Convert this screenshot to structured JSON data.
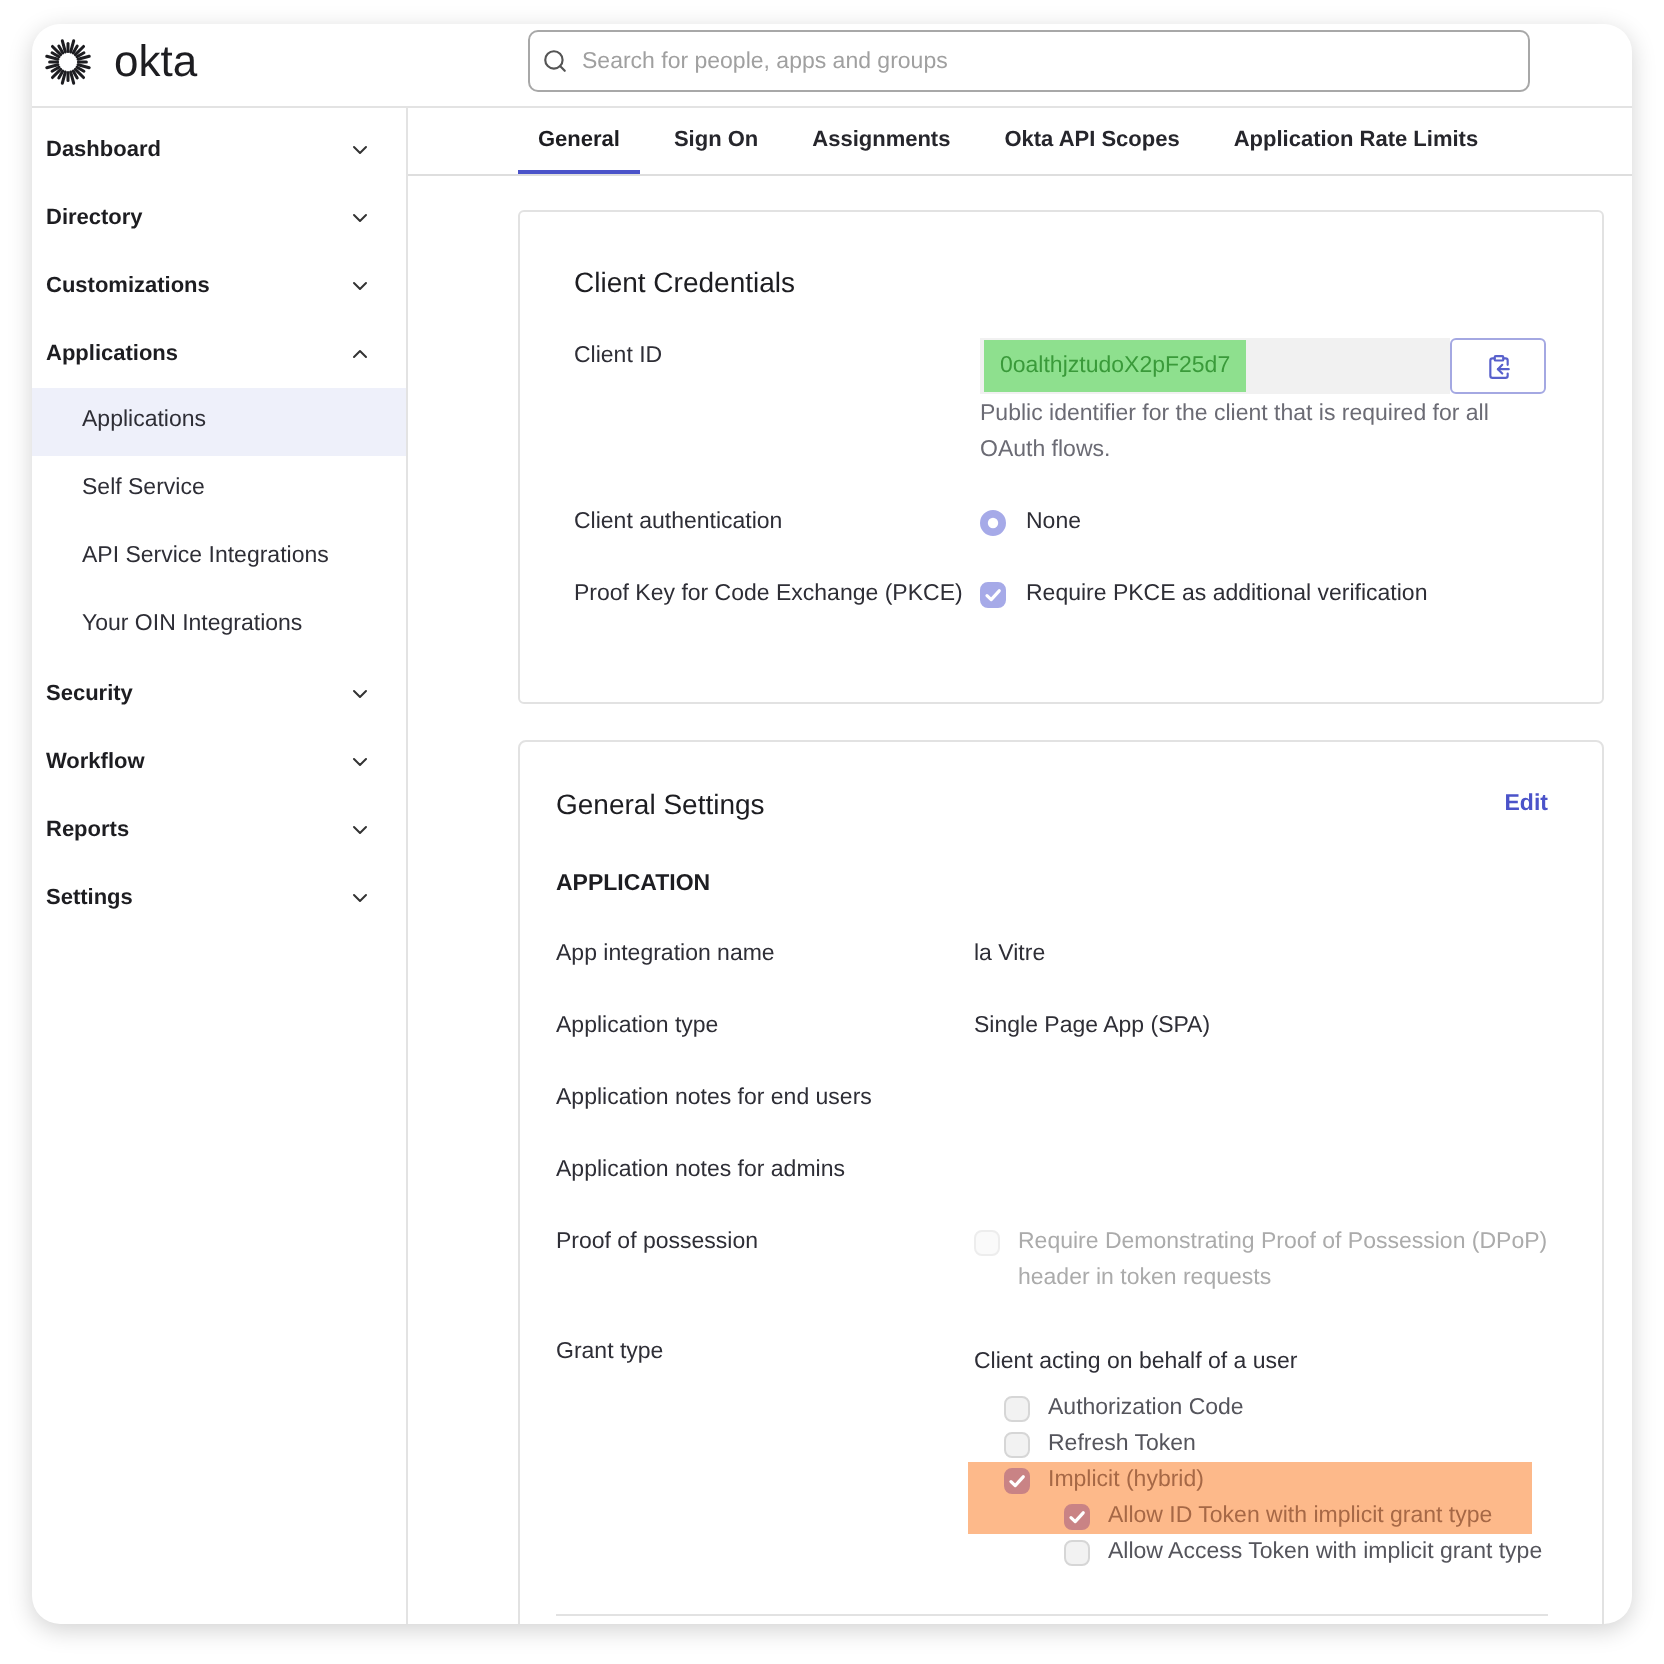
{
  "header": {
    "logo": "okta",
    "search": {
      "placeholder": "Search for people, apps and groups"
    }
  },
  "sidebar": {
    "items": [
      {
        "label": "Dashboard",
        "expanded": false
      },
      {
        "label": "Directory",
        "expanded": false
      },
      {
        "label": "Customizations",
        "expanded": false
      },
      {
        "label": "Applications",
        "expanded": true,
        "children": [
          {
            "label": "Applications",
            "selected": true
          },
          {
            "label": "Self Service",
            "selected": false
          },
          {
            "label": "API Service Integrations",
            "selected": false
          },
          {
            "label": "Your OIN Integrations",
            "selected": false
          }
        ]
      },
      {
        "label": "Security",
        "expanded": false
      },
      {
        "label": "Workflow",
        "expanded": false
      },
      {
        "label": "Reports",
        "expanded": false
      },
      {
        "label": "Settings",
        "expanded": false
      }
    ]
  },
  "tabs": [
    {
      "label": "General",
      "selected": true
    },
    {
      "label": "Sign On",
      "selected": false
    },
    {
      "label": "Assignments",
      "selected": false
    },
    {
      "label": "Okta API Scopes",
      "selected": false
    },
    {
      "label": "Application Rate Limits",
      "selected": false
    }
  ],
  "client_credentials": {
    "title": "Client Credentials",
    "client_id": {
      "label": "Client ID",
      "value": "0oalthjztudoX2pF25d7",
      "highlighted": true,
      "help": "Public identifier for the client that is required for all OAuth flows."
    },
    "client_authentication": {
      "label": "Client authentication",
      "options": [
        {
          "label": "None",
          "selected": true
        }
      ]
    },
    "pkce": {
      "label": "Proof Key for Code Exchange (PKCE)",
      "option": {
        "label": "Require PKCE as additional verification",
        "checked": true
      }
    }
  },
  "general_settings": {
    "title": "General Settings",
    "edit": "Edit",
    "section": "APPLICATION",
    "fields": [
      {
        "kind": "text",
        "label": "App integration name",
        "value": "la Vitre"
      },
      {
        "kind": "text",
        "label": "Application type",
        "value": "Single Page App (SPA)"
      },
      {
        "kind": "text",
        "label": "Application notes for end users"
      },
      {
        "kind": "text",
        "label": "Application notes for admins"
      },
      {
        "kind": "checkbox",
        "label": "Proof of possession",
        "option": {
          "label": "Require Demonstrating Proof of Possession (DPoP) header in token requests",
          "checked": false,
          "disabled": true
        }
      },
      {
        "kind": "checklist",
        "label": "Grant type",
        "heading": "Client acting on behalf of a user",
        "options": [
          {
            "label": "Authorization Code",
            "checked": false,
            "highlighted": false
          },
          {
            "label": "Refresh Token",
            "checked": false,
            "highlighted": false
          },
          {
            "label": "Implicit (hybrid)",
            "checked": true,
            "highlighted": true,
            "children": [
              {
                "label": "Allow ID Token with implicit grant type",
                "checked": true,
                "highlighted": true
              },
              {
                "label": "Allow Access Token with implicit grant type",
                "checked": false,
                "highlighted": false
              }
            ]
          }
        ]
      }
    ]
  }
}
